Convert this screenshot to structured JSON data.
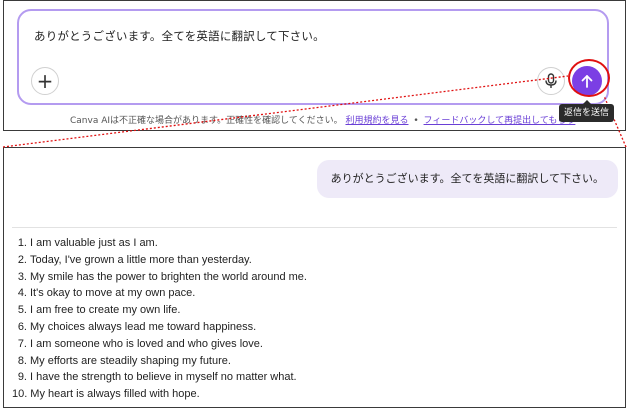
{
  "composer": {
    "text": "ありがとうございます。全てを英語に翻訳して下さい。",
    "plus_glyph": "+",
    "add_icon": "plus-icon",
    "mic_icon": "microphone-icon",
    "send_icon": "arrow-up-icon",
    "send_tooltip": "返信を送信",
    "accent_color": "#7b3fe4",
    "border_color": "#b49bf0",
    "highlight_color": "#e01010"
  },
  "disclaimer": {
    "text": "Canva AIは不正確な場合があります。正確性を確認してください。",
    "separator": "•",
    "terms_link": "利用規約を見る",
    "feedback_link": "フィードバックして再提出してもらう"
  },
  "conversation": {
    "user_message": "ありがとうございます。全てを英語に翻訳して下さい。",
    "bubble_color": "#eeeaf8",
    "answer_items": [
      {
        "num": "1.",
        "text": "I am valuable just as I am."
      },
      {
        "num": "2.",
        "text": "Today, I've grown a little more than yesterday."
      },
      {
        "num": "3.",
        "text": "My smile has the power to brighten the world around me."
      },
      {
        "num": "4.",
        "text": "It's okay to move at my own pace."
      },
      {
        "num": "5.",
        "text": "I am free to create my own life."
      },
      {
        "num": "6.",
        "text": "My choices always lead me toward happiness."
      },
      {
        "num": "7.",
        "text": "I am someone who is loved and who gives love."
      },
      {
        "num": "8.",
        "text": "My efforts are steadily shaping my future."
      },
      {
        "num": "9.",
        "text": "I have the strength to believe in myself no matter what."
      },
      {
        "num": "10.",
        "text": "My heart is always filled with hope."
      }
    ]
  }
}
